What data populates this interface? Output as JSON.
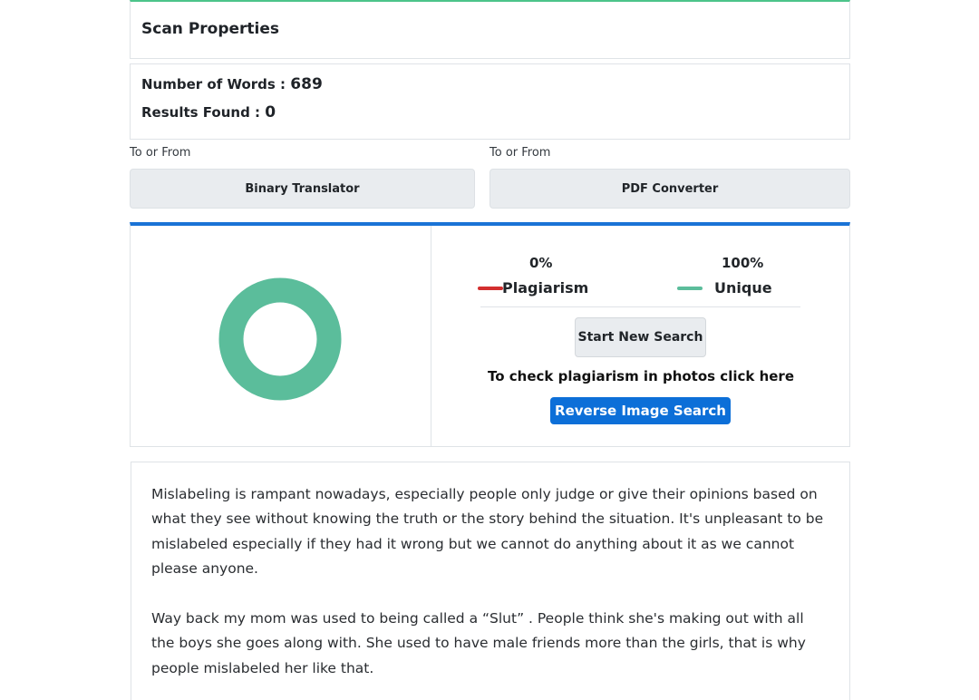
{
  "scan": {
    "title": "Scan Properties",
    "words_label": "Number of Words :",
    "words_value": "689",
    "results_label": "Results Found :",
    "results_value": "0"
  },
  "tools": [
    {
      "label": "To or From",
      "button": "Binary Translator"
    },
    {
      "label": "To or From",
      "button": "PDF Converter"
    }
  ],
  "result": {
    "plagiarism_percent": "0%",
    "plagiarism_label": "Plagiarism",
    "unique_percent": "100%",
    "unique_label": "Unique",
    "plagiarism_fraction": 0,
    "unique_fraction": 1,
    "start_button": "Start New Search",
    "photo_text": "To check plagiarism in photos click here",
    "reverse_button": "Reverse Image Search"
  },
  "colors": {
    "plagiarism": "#d32f2f",
    "unique": "#5bbd9b",
    "accent": "#1a73d6",
    "header_accent": "#4cc48a"
  },
  "text": {
    "paragraphs": [
      "Mislabeling is rampant nowadays, especially people only judge or give their opinions based on what they see without knowing the truth or the story behind the situation. It's unpleasant to be mislabeled especially if they had it wrong but we cannot do anything about it as we cannot please anyone.",
      "Way back my mom was used to being called a “Slut” . People think she's making out with all the boys she goes along with. She used to have male friends more than the girls, that is why people mislabeled her like that."
    ]
  }
}
